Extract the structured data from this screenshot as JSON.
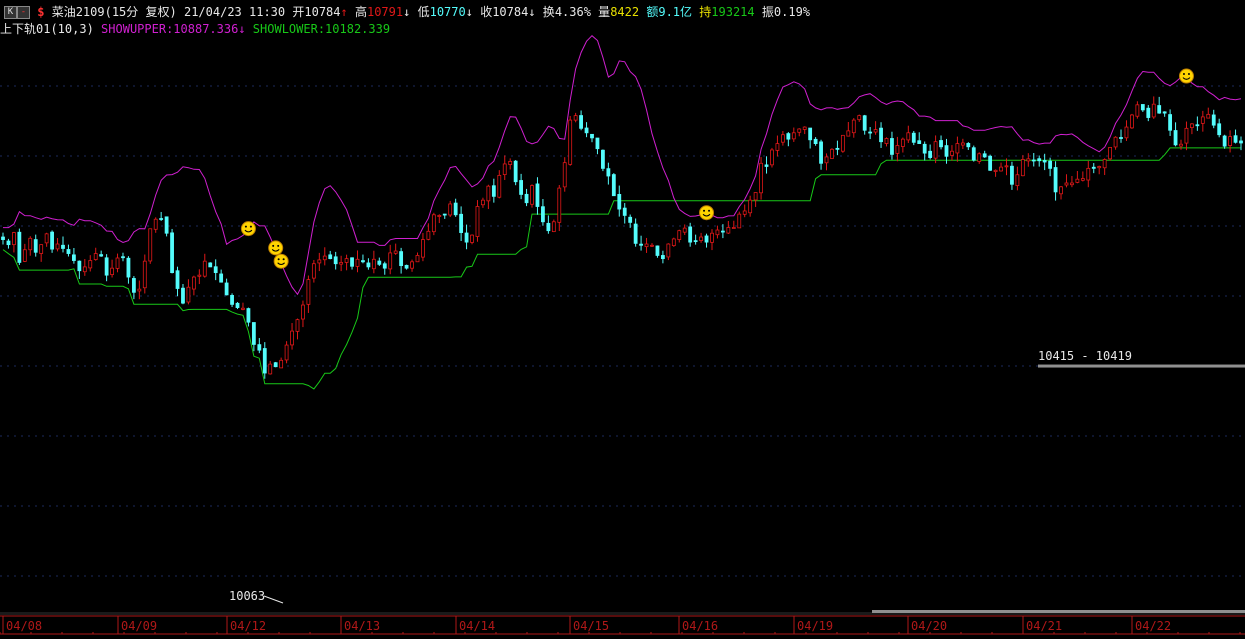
{
  "header": {
    "k_button": "K",
    "collapse_button": "-",
    "dollar_icon": "$",
    "instrument": "菜油2109(15分 复权)",
    "datetime": "21/04/23 11:30",
    "open_label": "开",
    "open_value": "10784",
    "open_arrow": "↑",
    "high_label": "高",
    "high_value": "10791",
    "high_arrow": "↓",
    "low_label": "低",
    "low_value": "10770",
    "low_arrow": "↓",
    "close_label": "收",
    "close_value": "10784",
    "close_arrow": "↓",
    "turnover_label": "换",
    "turnover_value": "4.36%",
    "volume_label": "量",
    "volume_value": "8422",
    "amount_label": "额",
    "amount_value": "9.1亿",
    "oi_label": "持",
    "oi_value": "193214",
    "amp_label": "振",
    "amp_value": "0.19%"
  },
  "indicator": {
    "name": "上下轨01(10,3)",
    "upper_label": "SHOWUPPER:",
    "upper_value": "10887.336",
    "upper_arrow": "↓",
    "lower_label": "SHOWLOWER:",
    "lower_value": "10182.339"
  },
  "colors": {
    "bg": "#000000",
    "up": "#e01818",
    "down": "#54fcfc",
    "upper": "#d020d0",
    "lower": "#18c818",
    "axis_red": "#b01818",
    "white": "#e8e8e8",
    "yellow": "#e8e000",
    "grid": "#1c2a5c"
  },
  "chart_data": {
    "type": "candlestick",
    "x_labels": [
      "04/08",
      "04/09",
      "04/12",
      "04/13",
      "04/14",
      "04/15",
      "04/16",
      "04/19",
      "04/20",
      "04/21",
      "04/22"
    ],
    "ylim": [
      10030,
      10930
    ],
    "price_min_annotation": "10063",
    "price_range_annotation": "10415 - 10419",
    "marker": "smiley",
    "close_series": [
      10616,
      10608,
      10627,
      10580,
      10600,
      10618,
      10596,
      10608,
      10625,
      10601,
      10609,
      10602,
      10594,
      10583,
      10567,
      10573,
      10583,
      10594,
      10590,
      10560,
      10571,
      10587,
      10588,
      10557,
      10533,
      10538,
      10582,
      10633,
      10648,
      10649,
      10626,
      10564,
      10539,
      10516,
      10541,
      10557,
      10560,
      10582,
      10573,
      10564,
      10549,
      10529,
      10514,
      10509,
      10508,
      10486,
      10451,
      10442,
      10406,
      10420,
      10416,
      10426,
      10450,
      10472,
      10490,
      10513,
      10553,
      10578,
      10584,
      10590,
      10586,
      10578,
      10580,
      10586,
      10574,
      10585,
      10581,
      10573,
      10585,
      10577,
      10571,
      10595,
      10598,
      10575,
      10571,
      10581,
      10591,
      10616,
      10629,
      10655,
      10654,
      10656,
      10672,
      10655,
      10627,
      10612,
      10623,
      10668,
      10678,
      10700,
      10684,
      10717,
      10735,
      10739,
      10707,
      10687,
      10674,
      10701,
      10668,
      10644,
      10630,
      10644,
      10697,
      10737,
      10804,
      10811,
      10791,
      10784,
      10776,
      10759,
      10728,
      10716,
      10685,
      10664,
      10654,
      10643,
      10610,
      10607,
      10609,
      10607,
      10591,
      10586,
      10609,
      10617,
      10630,
      10634,
      10612,
      10613,
      10620,
      10612,
      10626,
      10631,
      10628,
      10635,
      10635,
      10656,
      10661,
      10678,
      10690,
      10736,
      10731,
      10757,
      10767,
      10781,
      10774,
      10784,
      10790,
      10793,
      10773,
      10767,
      10736,
      10746,
      10758,
      10758,
      10780,
      10787,
      10804,
      10811,
      10788,
      10784,
      10789,
      10770,
      10775,
      10750,
      10764,
      10774,
      10784,
      10769,
      10767,
      10752,
      10745,
      10770,
      10762,
      10747,
      10755,
      10767,
      10768,
      10762,
      10741,
      10751,
      10746,
      10725,
      10725,
      10730,
      10732,
      10703,
      10718,
      10742,
      10743,
      10741,
      10740,
      10738,
      10728,
      10691,
      10699,
      10705,
      10705,
      10711,
      10712,
      10728,
      10728,
      10731,
      10742,
      10761,
      10777,
      10776,
      10793,
      10812,
      10828,
      10820,
      10808,
      10829,
      10815,
      10815,
      10788,
      10765,
      10766,
      10791,
      10798,
      10796,
      10809,
      10813,
      10796,
      10781,
      10763,
      10778,
      10769,
      10768
    ]
  }
}
